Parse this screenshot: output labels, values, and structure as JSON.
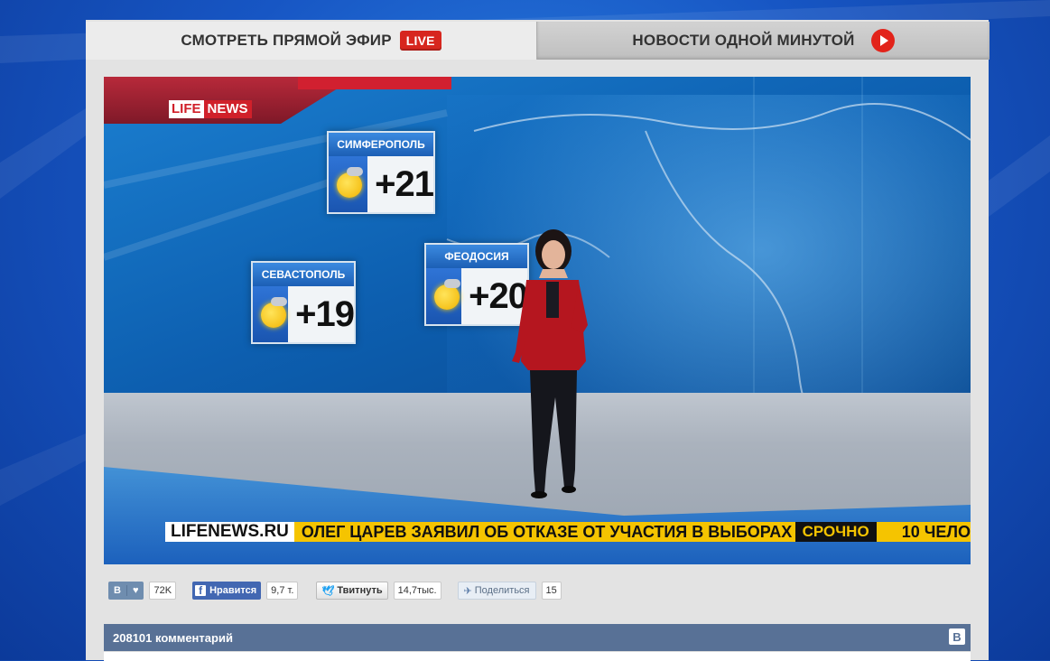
{
  "tabs": {
    "live_label": "СМОТРЕТЬ ПРЯМОЙ ЭФИР",
    "live_badge": "LIVE",
    "news_label": "НОВОСТИ ОДНОЙ МИНУТОЙ"
  },
  "video": {
    "logo_left": "LIFE",
    "logo_right": "NEWS",
    "weather": [
      {
        "city": "СИМФЕРОПОЛЬ",
        "temp": "+21"
      },
      {
        "city": "СЕВАСТОПОЛЬ",
        "temp": "+19"
      },
      {
        "city": "ФЕОДОСИЯ",
        "temp": "+20"
      }
    ],
    "ticker": {
      "site": "LIFENEWS.RU",
      "headline": "ОЛЕГ ЦАРЕВ ЗАЯВИЛ ОБ ОТКАЗЕ ОТ УЧАСТИЯ В ВЫБОРАХ",
      "urgent": "СРОЧНО",
      "rest": "10 ЧЕЛО"
    }
  },
  "share": {
    "vk_label": "В",
    "vk_count": "72K",
    "fb_label": "Нравится",
    "fb_count": "9,7 т.",
    "tw_label": "Твитнуть",
    "tw_count": "14,7тыс.",
    "share_label": "Поделиться",
    "share_count": "15"
  },
  "comments": {
    "title": "208101 комментарий",
    "vk_icon_label": "В"
  },
  "colors": {
    "accent_red": "#d7261e",
    "ticker_yellow": "#f5c400",
    "comments_bar": "#587196"
  }
}
